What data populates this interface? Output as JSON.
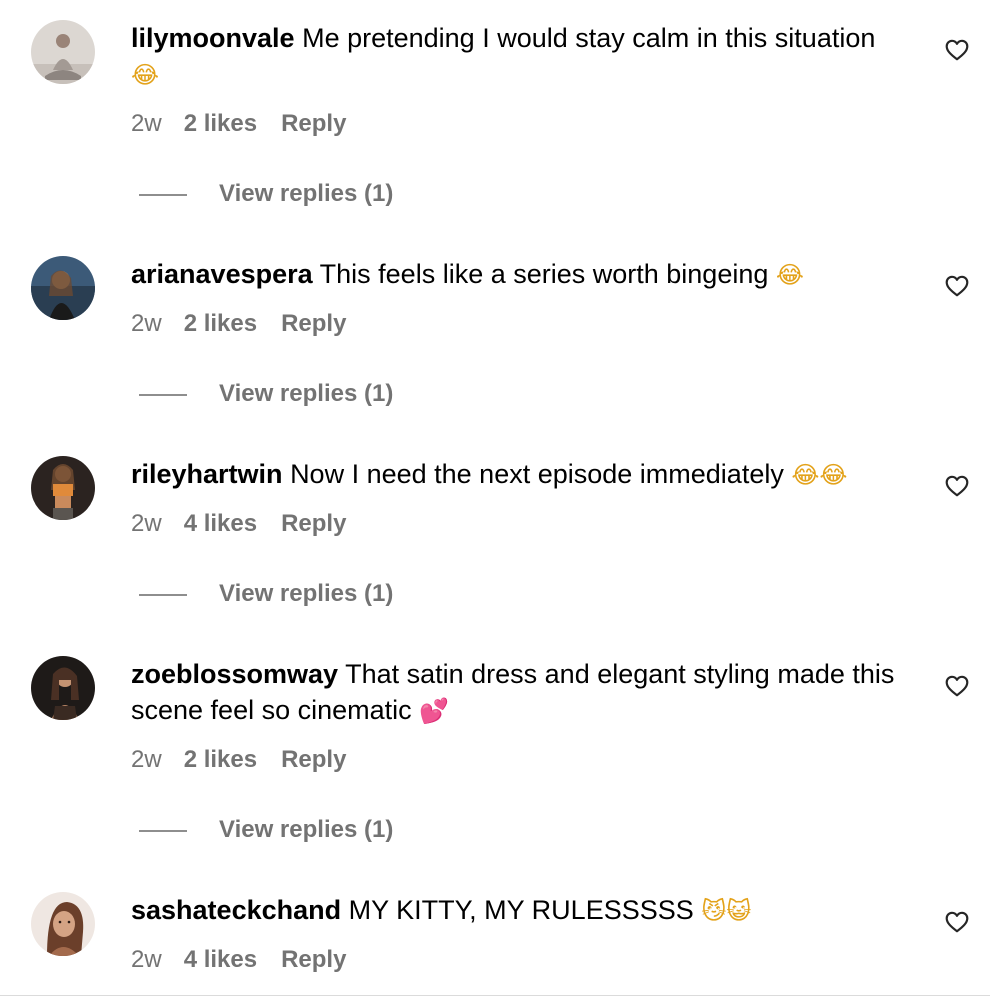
{
  "comments": [
    {
      "username": "lilymoonvale",
      "text": "Me pretending I would stay calm in this situation",
      "emoji": "😂",
      "time": "2w",
      "likes": "2 likes",
      "reply": "Reply",
      "view_replies": "View replies (1)",
      "avatar_colors": [
        "#d9d4cf",
        "#8c7b70"
      ]
    },
    {
      "username": "arianavespera",
      "text": "This feels like a series worth bingeing",
      "emoji": "😂",
      "time": "2w",
      "likes": "2 likes",
      "reply": "Reply",
      "view_replies": "View replies (1)",
      "avatar_colors": [
        "#2f4a66",
        "#c9a27a"
      ]
    },
    {
      "username": "rileyhartwin",
      "text": "Now I need the next episode immediately",
      "emoji": "😂😂",
      "time": "2w",
      "likes": "4 likes",
      "reply": "Reply",
      "view_replies": "View replies (1)",
      "avatar_colors": [
        "#2b2320",
        "#c98a5c"
      ]
    },
    {
      "username": "zoeblossomway",
      "text": "That satin dress and elegant styling made this scene feel so cinematic",
      "emoji": "💕",
      "time": "2w",
      "likes": "2 likes",
      "reply": "Reply",
      "view_replies": "View replies (1)",
      "avatar_colors": [
        "#1e1a18",
        "#b88565"
      ]
    },
    {
      "username": "sashateckchand",
      "text": "MY KITTY, MY RULESSSSS",
      "emoji": "😼😺",
      "time": "2w",
      "likes": "4 likes",
      "reply": "Reply",
      "avatar_colors": [
        "#efe7e2",
        "#a36a4c"
      ]
    }
  ],
  "icons": {
    "like": "heart-outline-icon"
  },
  "colors": {
    "meta_text": "#737373",
    "divider": "#dbdbdb"
  }
}
